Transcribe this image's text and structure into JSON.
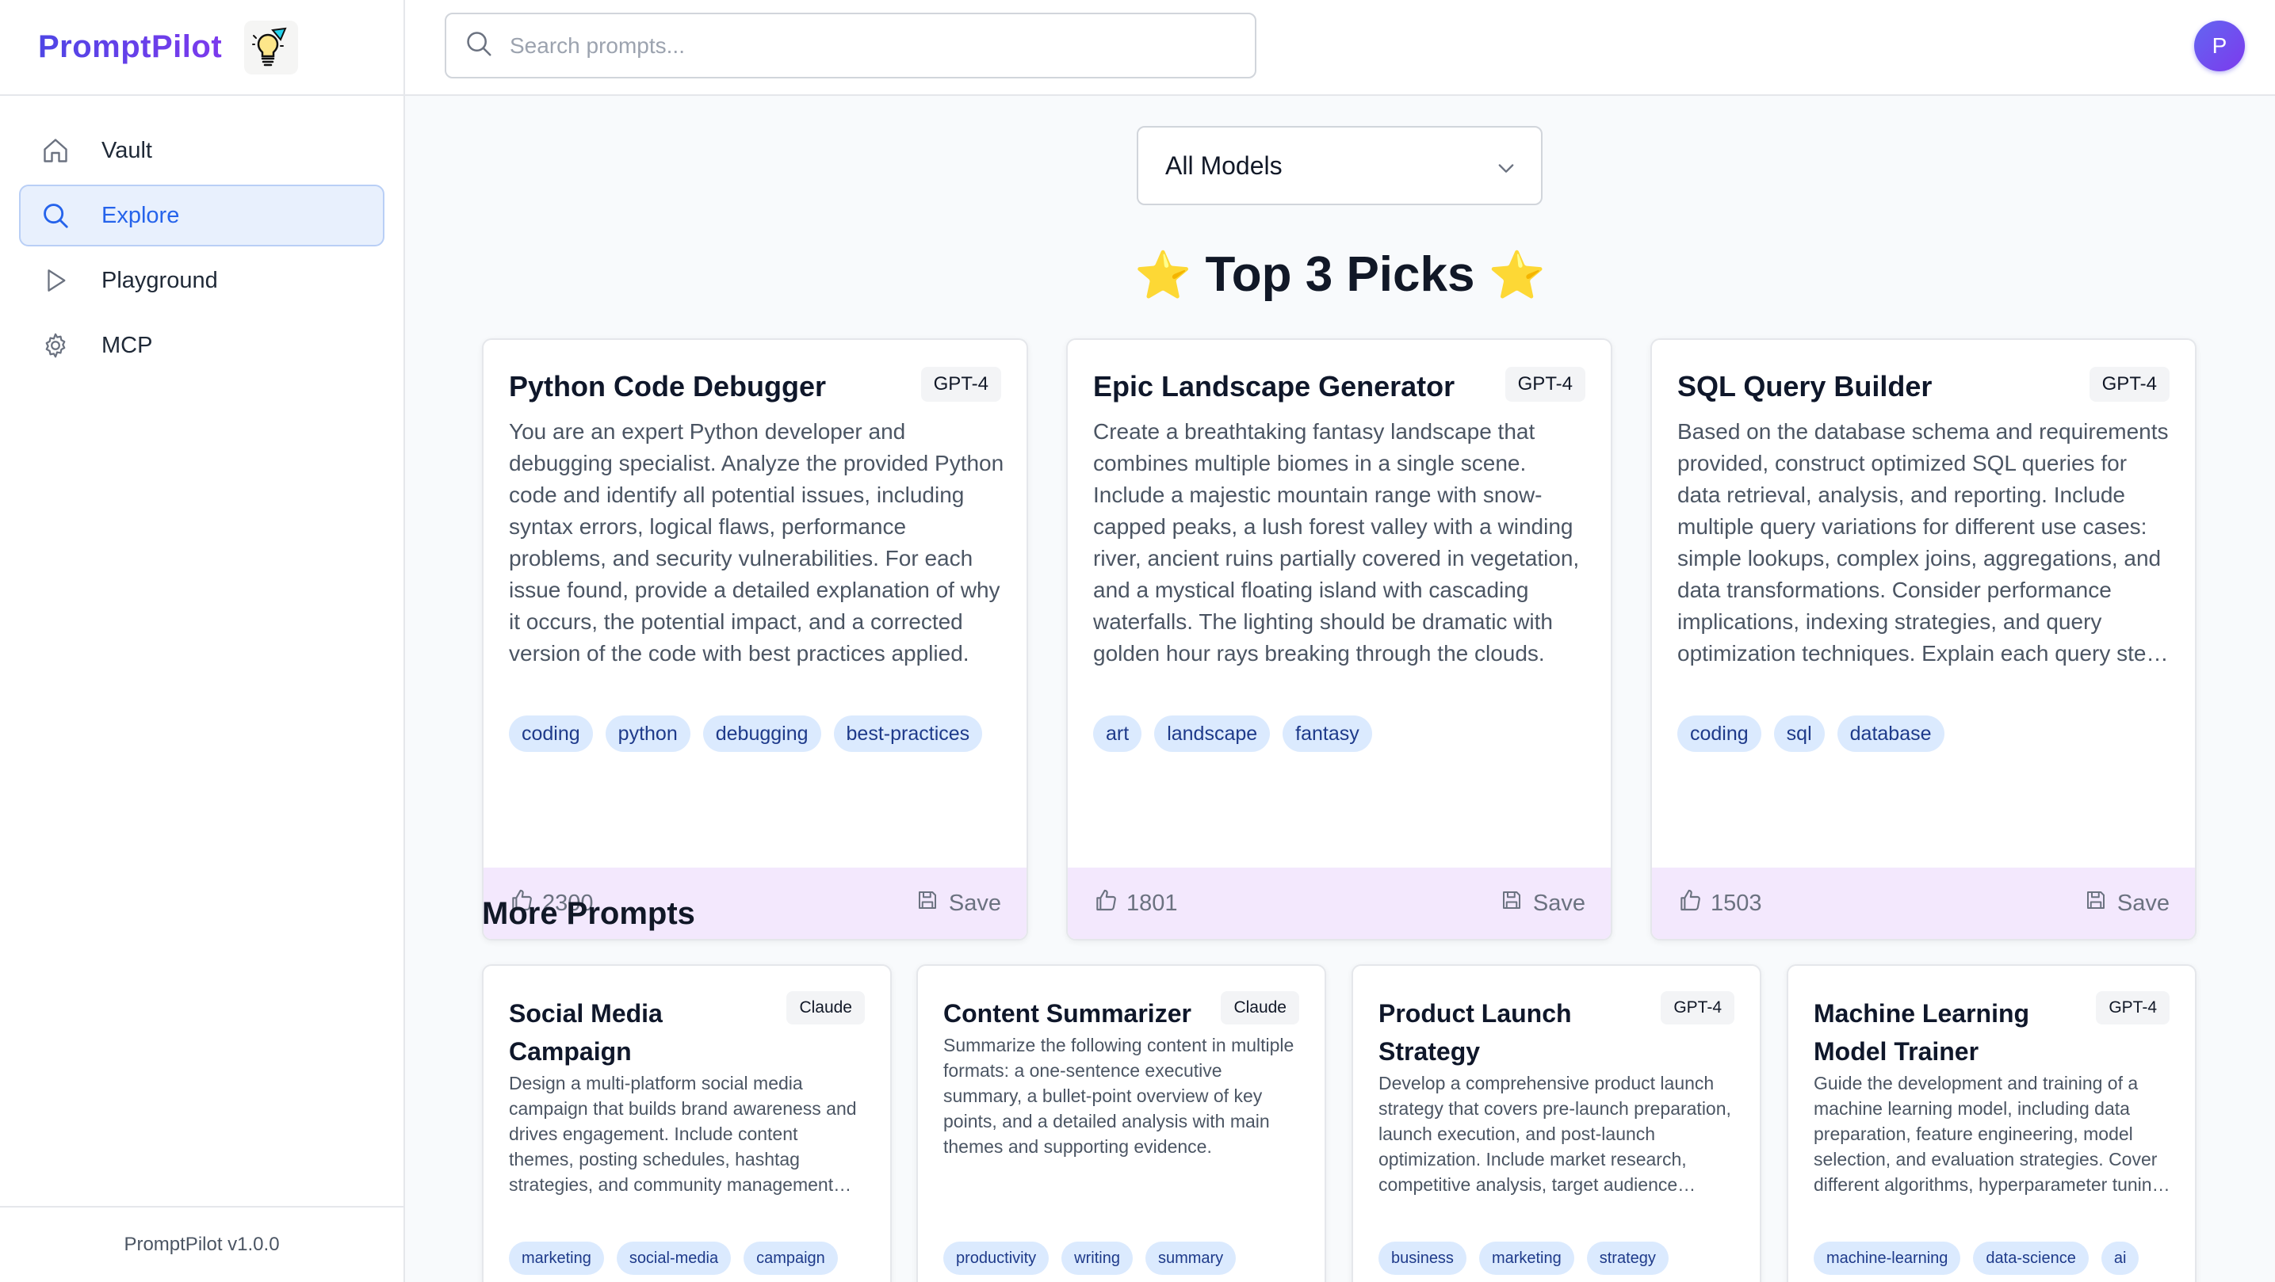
{
  "app": {
    "brand": "PromptPilot",
    "version": "PromptPilot v1.0.0"
  },
  "sidebar": {
    "items": [
      {
        "label": "Vault",
        "icon": "home-icon",
        "active": false
      },
      {
        "label": "Explore",
        "icon": "search-icon",
        "active": true
      },
      {
        "label": "Playground",
        "icon": "play-icon",
        "active": false
      },
      {
        "label": "MCP",
        "icon": "gear-icon",
        "active": false
      }
    ]
  },
  "header": {
    "search_placeholder": "Search prompts...",
    "avatar_initial": "P"
  },
  "filter": {
    "selected": "All Models"
  },
  "top_picks": {
    "title": "Top 3 Picks",
    "cards": [
      {
        "title": "Python Code Debugger",
        "model": "GPT-4",
        "description": "You are an expert Python developer and debugging specialist. Analyze the provided Python code and identify all potential issues, including syntax errors, logical flaws, performance problems, and security vulnerabilities. For each issue found, provide a detailed explanation of why it occurs, the potential impact, and a corrected version of the code with best practices applied.",
        "tags": [
          "coding",
          "python",
          "debugging",
          "best-practices"
        ],
        "likes": "2300",
        "save_label": "Save"
      },
      {
        "title": "Epic Landscape Generator",
        "model": "GPT-4",
        "description": "Create a breathtaking fantasy landscape that combines multiple biomes in a single scene. Include a majestic mountain range with snow-capped peaks, a lush forest valley with a winding river, ancient ruins partially covered in vegetation, and a mystical floating island with cascading waterfalls. The lighting should be dramatic with golden hour rays breaking through the clouds.",
        "tags": [
          "art",
          "landscape",
          "fantasy"
        ],
        "likes": "1801",
        "save_label": "Save"
      },
      {
        "title": "SQL Query Builder",
        "model": "GPT-4",
        "description": "Based on the database schema and requirements provided, construct optimized SQL queries for data retrieval, analysis, and reporting. Include multiple query variations for different use cases: simple lookups, complex joins, aggregations, and data transformations. Consider performance implications, indexing strategies, and query optimization techniques. Explain each query step by step.",
        "tags": [
          "coding",
          "sql",
          "database"
        ],
        "likes": "1503",
        "save_label": "Save"
      }
    ]
  },
  "more_prompts": {
    "title": "More Prompts",
    "cards": [
      {
        "title": "Social Media Campaign",
        "model": "Claude",
        "description": "Design a multi-platform social media campaign that builds brand awareness and drives engagement. Include content themes, posting schedules, hashtag strategies, and community management guidelines for each platform.",
        "tags": [
          "marketing",
          "social-media",
          "campaign"
        ]
      },
      {
        "title": "Content Summarizer",
        "model": "Claude",
        "description": "Summarize the following content in multiple formats: a one-sentence executive summary, a bullet-point overview of key points, and a detailed analysis with main themes and supporting evidence.",
        "tags": [
          "productivity",
          "writing",
          "summary"
        ]
      },
      {
        "title": "Product Launch Strategy",
        "model": "GPT-4",
        "description": "Develop a comprehensive product launch strategy that covers pre-launch preparation, launch execution, and post-launch optimization. Include market research, competitive analysis, target audience definition, and messaging.",
        "tags": [
          "business",
          "marketing",
          "strategy"
        ]
      },
      {
        "title": "Machine Learning Model Trainer",
        "model": "GPT-4",
        "description": "Guide the development and training of a machine learning model, including data preparation, feature engineering, model selection, and evaluation strategies. Cover different algorithms, hyperparameter tuning and validation.",
        "tags": [
          "machine-learning",
          "data-science",
          "ai"
        ]
      }
    ]
  },
  "colors": {
    "brand": "#4f46e5",
    "active_nav": "#2563eb",
    "tag_bg": "#dbeafe",
    "card_footer_bg": "#f3e8fd",
    "star": "#f5b301"
  }
}
